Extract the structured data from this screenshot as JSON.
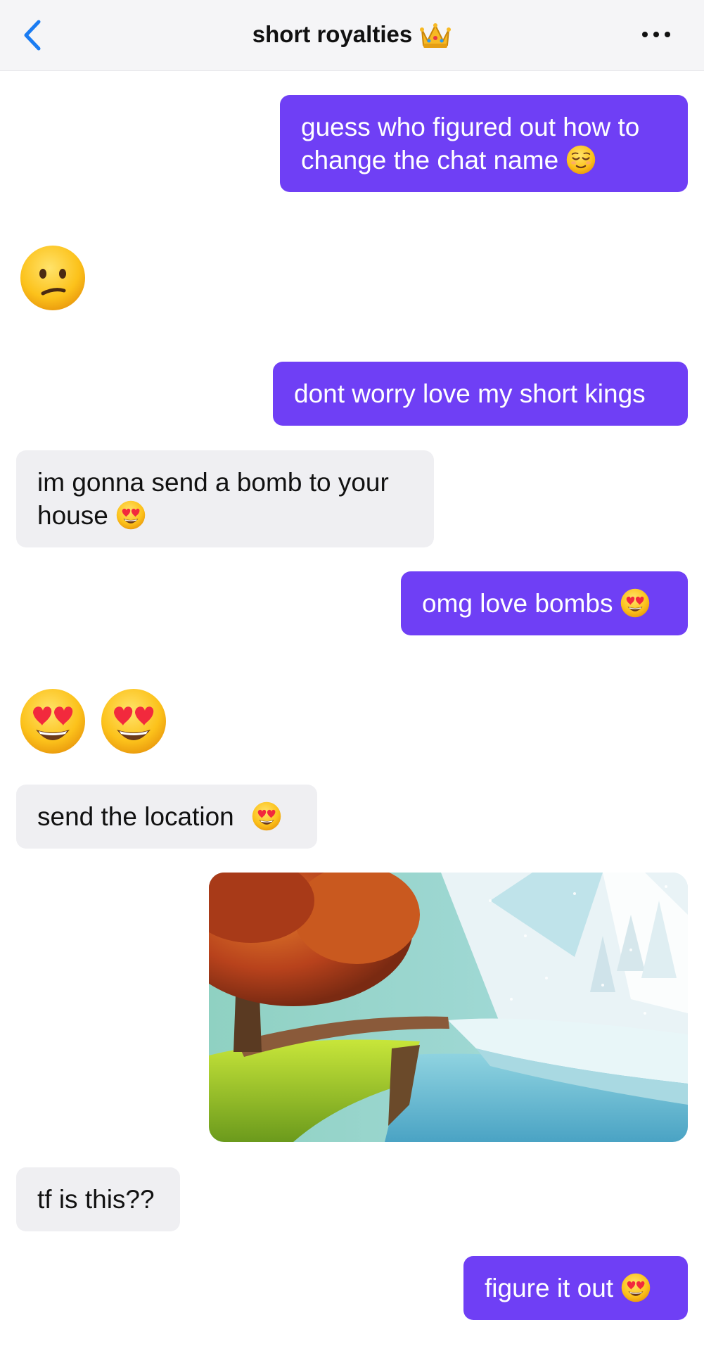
{
  "header": {
    "title": "short royalties",
    "title_icon": "crown-emoji",
    "back_icon": "chevron-left-icon",
    "more_icon": "ellipsis-icon"
  },
  "colors": {
    "outgoing_bubble": "#6f3ff5",
    "incoming_bubble": "#efeff2",
    "accent": "#1a7cf2"
  },
  "messages": [
    {
      "side": "out",
      "text": "guess who figured out how to change the chat name",
      "emoji": "relieved-face"
    },
    {
      "side": "in",
      "emoji_only": [
        "confused-face"
      ]
    },
    {
      "side": "out",
      "text": "dont worry love my short kings"
    },
    {
      "side": "in",
      "text": "im gonna send a bomb to your house",
      "emoji": "heart-eyes-face"
    },
    {
      "side": "out",
      "text": "omg love bombs",
      "emoji": "heart-eyes-face"
    },
    {
      "side": "in",
      "emoji_only": [
        "heart-eyes-face",
        "heart-eyes-face"
      ]
    },
    {
      "side": "in",
      "text": "send the location",
      "emoji": "heart-eyes-face"
    },
    {
      "side": "out",
      "image": "autumn-winter-landscape-photo"
    },
    {
      "side": "in",
      "text": "tf is this??"
    },
    {
      "side": "out",
      "text": "figure it out",
      "emoji": "heart-eyes-face"
    }
  ]
}
